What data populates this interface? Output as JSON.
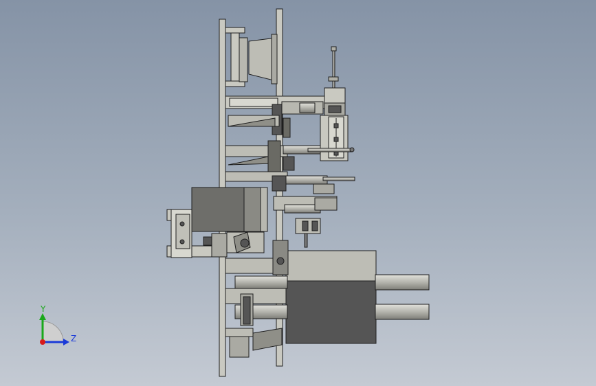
{
  "viewport": {
    "background_top": "#8593a6",
    "background_bottom": "#c4cad3"
  },
  "triad": {
    "y_label": "Y",
    "z_label": "Z",
    "y_color": "#1aa81a",
    "z_color": "#1a3ad8",
    "x_color": "#d81a1a"
  },
  "model": {
    "body_color": "#c9c9c1",
    "shadow_color": "#8f8f88",
    "dark_block_color": "#555555",
    "edge_color": "#1e1e1e"
  }
}
